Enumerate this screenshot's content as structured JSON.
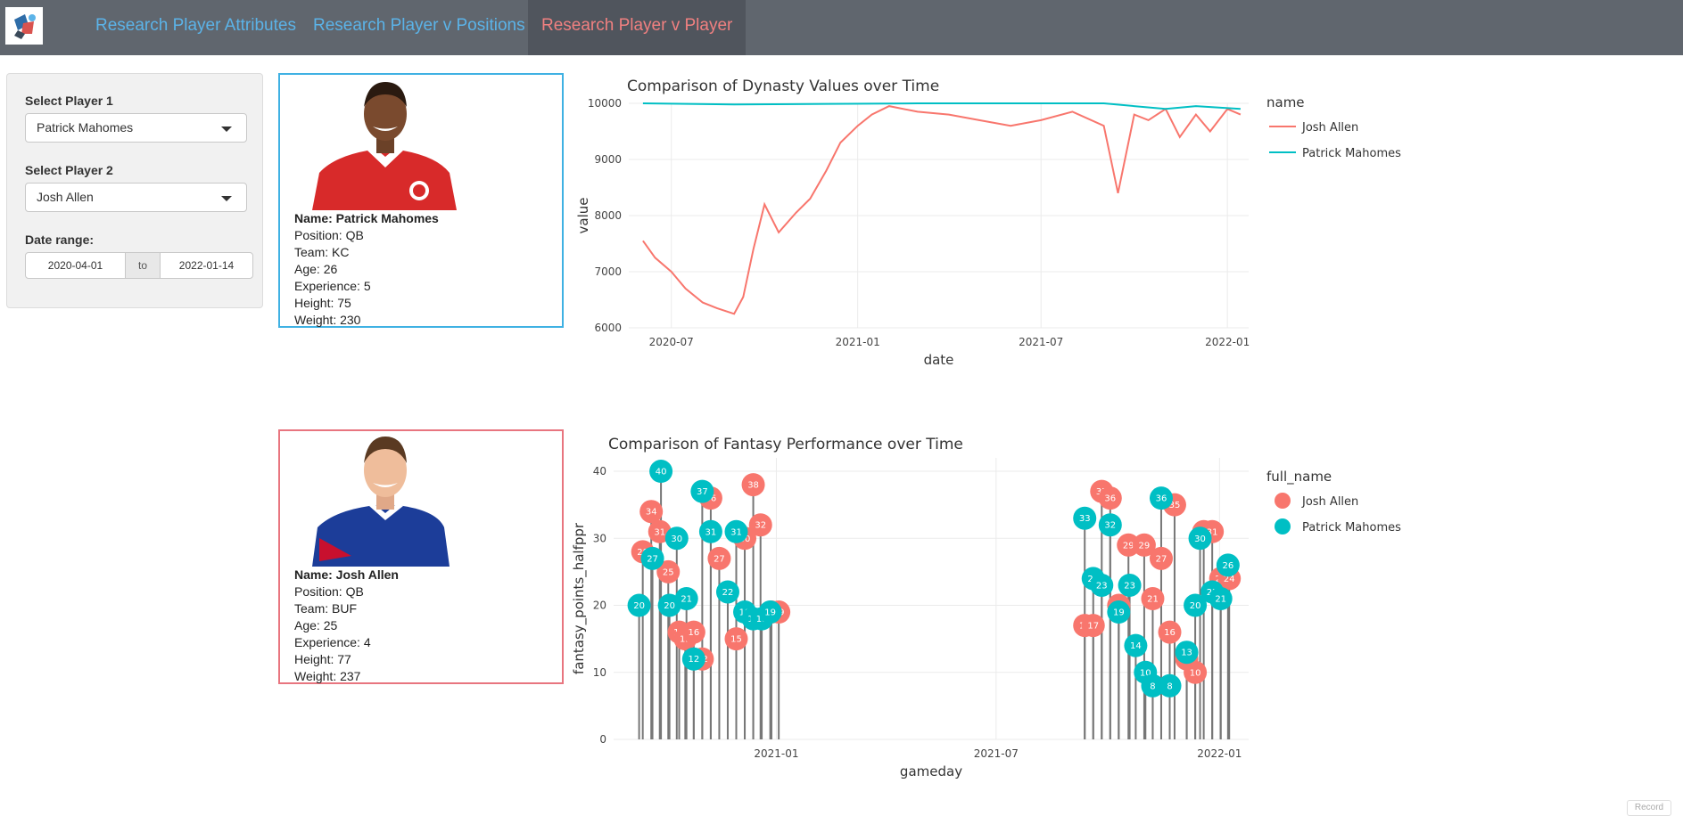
{
  "nav": {
    "tabs": [
      {
        "label": "Research Player Attributes"
      },
      {
        "label": "Research Player v Positions"
      },
      {
        "label": "Research Player v Player"
      }
    ],
    "colors": {
      "inactive": "#5bb3e8",
      "active": "#f08080",
      "bar": "#60666e"
    }
  },
  "sidebar": {
    "player1": {
      "label": "Select Player 1",
      "value": "Patrick Mahomes"
    },
    "player2": {
      "label": "Select Player 2",
      "value": "Josh Allen"
    },
    "date_range": {
      "label": "Date range:",
      "start": "2020-04-01",
      "sep": "to",
      "end": "2022-01-14"
    }
  },
  "cards": [
    {
      "name": "Name: Patrick Mahomes",
      "position": "Position: QB",
      "team": "Team: KC",
      "age": "Age: 26",
      "experience": "Experience: 5",
      "height": "Height: 75",
      "weight": "Weight: 230",
      "border_color": "#3fb1e3",
      "jersey_color": "#d82a2a"
    },
    {
      "name": "Name: Josh Allen",
      "position": "Position: QB",
      "team": "Team: BUF",
      "age": "Age: 25",
      "experience": "Experience: 4",
      "height": "Height: 77",
      "weight": "Weight: 237",
      "border_color": "#e8757f",
      "jersey_color": "#1c3d99"
    }
  ],
  "chart_data": [
    {
      "type": "line",
      "title": "Comparison of Dynasty Values over Time",
      "xlabel": "date",
      "ylabel": "value",
      "xticks": [
        "2020-07",
        "2021-01",
        "2021-07",
        "2022-01"
      ],
      "yticks": [
        6000,
        7000,
        8000,
        9000,
        10000
      ],
      "ylim": [
        6000,
        10000
      ],
      "legend_title": "name",
      "series": [
        {
          "name": "Josh Allen",
          "color": "#f8766d",
          "x": [
            "2020-06-03",
            "2020-06-15",
            "2020-07-01",
            "2020-07-15",
            "2020-08-01",
            "2020-08-15",
            "2020-09-01",
            "2020-09-10",
            "2020-09-20",
            "2020-10-01",
            "2020-10-15",
            "2020-11-01",
            "2020-11-15",
            "2020-12-01",
            "2020-12-15",
            "2021-01-01",
            "2021-01-15",
            "2021-02-01",
            "2021-03-01",
            "2021-04-01",
            "2021-05-01",
            "2021-06-01",
            "2021-07-01",
            "2021-08-01",
            "2021-09-01",
            "2021-09-15",
            "2021-10-01",
            "2021-10-15",
            "2021-11-01",
            "2021-11-15",
            "2021-12-01",
            "2021-12-15",
            "2022-01-01",
            "2022-01-14"
          ],
          "y": [
            7550,
            7250,
            7000,
            6700,
            6450,
            6350,
            6250,
            6550,
            7400,
            8200,
            7700,
            8050,
            8300,
            8800,
            9300,
            9600,
            9800,
            9950,
            9850,
            9800,
            9700,
            9600,
            9700,
            9850,
            9600,
            8400,
            9800,
            9700,
            9900,
            9400,
            9800,
            9500,
            9900,
            9800
          ]
        },
        {
          "name": "Patrick Mahomes",
          "color": "#00bfc4",
          "x": [
            "2020-06-03",
            "2020-09-01",
            "2020-12-01",
            "2021-03-01",
            "2021-06-01",
            "2021-09-01",
            "2021-11-01",
            "2021-12-01",
            "2022-01-14"
          ],
          "y": [
            10000,
            9980,
            9990,
            10000,
            10000,
            10000,
            9900,
            9950,
            9900
          ]
        }
      ]
    },
    {
      "type": "scatter",
      "title": "Comparison of Fantasy Performance over Time",
      "xlabel": "gameday",
      "ylabel": "fantasy_points_halfppr",
      "xticks": [
        "2021-01",
        "2021-07",
        "2022-01"
      ],
      "yticks": [
        0,
        10,
        20,
        30,
        40
      ],
      "ylim": [
        0,
        42
      ],
      "legend_title": "full_name",
      "series": [
        {
          "name": "Josh Allen",
          "color": "#f8766d",
          "x": [
            "2020-09-13",
            "2020-09-20",
            "2020-09-27",
            "2020-10-04",
            "2020-10-13",
            "2020-10-18",
            "2020-10-25",
            "2020-11-01",
            "2020-11-08",
            "2020-11-15",
            "2020-11-29",
            "2020-12-06",
            "2020-12-13",
            "2020-12-19",
            "2020-12-28",
            "2021-01-03",
            "2021-09-12",
            "2021-09-19",
            "2021-09-26",
            "2021-10-03",
            "2021-10-10",
            "2021-10-18",
            "2021-10-31",
            "2021-11-07",
            "2021-11-14",
            "2021-11-21",
            "2021-11-25",
            "2021-12-05",
            "2021-12-12",
            "2021-12-19",
            "2021-12-26",
            "2022-01-02",
            "2022-01-09"
          ],
          "y": [
            28,
            34,
            31,
            25,
            16,
            15,
            16,
            12,
            36,
            27,
            15,
            30,
            38,
            32,
            19,
            19,
            17,
            17,
            37,
            36,
            20,
            29,
            29,
            21,
            27,
            16,
            35,
            12,
            10,
            31,
            31,
            24,
            24
          ]
        },
        {
          "name": "Patrick Mahomes",
          "color": "#00bfc4",
          "x": [
            "2020-09-10",
            "2020-09-21",
            "2020-09-28",
            "2020-10-05",
            "2020-10-11",
            "2020-10-19",
            "2020-10-25",
            "2020-11-01",
            "2020-11-08",
            "2020-11-22",
            "2020-11-29",
            "2020-12-06",
            "2020-12-13",
            "2020-12-20",
            "2020-12-27",
            "2021-09-12",
            "2021-09-19",
            "2021-09-26",
            "2021-10-03",
            "2021-10-10",
            "2021-10-19",
            "2021-10-24",
            "2021-11-01",
            "2021-11-07",
            "2021-11-14",
            "2021-11-21",
            "2021-12-05",
            "2021-12-12",
            "2021-12-16",
            "2021-12-26",
            "2022-01-02",
            "2022-01-08"
          ],
          "y": [
            20,
            27,
            40,
            20,
            30,
            21,
            12,
            37,
            31,
            22,
            31,
            19,
            18,
            18,
            19,
            33,
            24,
            23,
            32,
            19,
            23,
            14,
            10,
            8,
            36,
            8,
            13,
            20,
            30,
            22,
            21,
            26
          ]
        }
      ]
    }
  ],
  "footer": {
    "record": "Record"
  }
}
